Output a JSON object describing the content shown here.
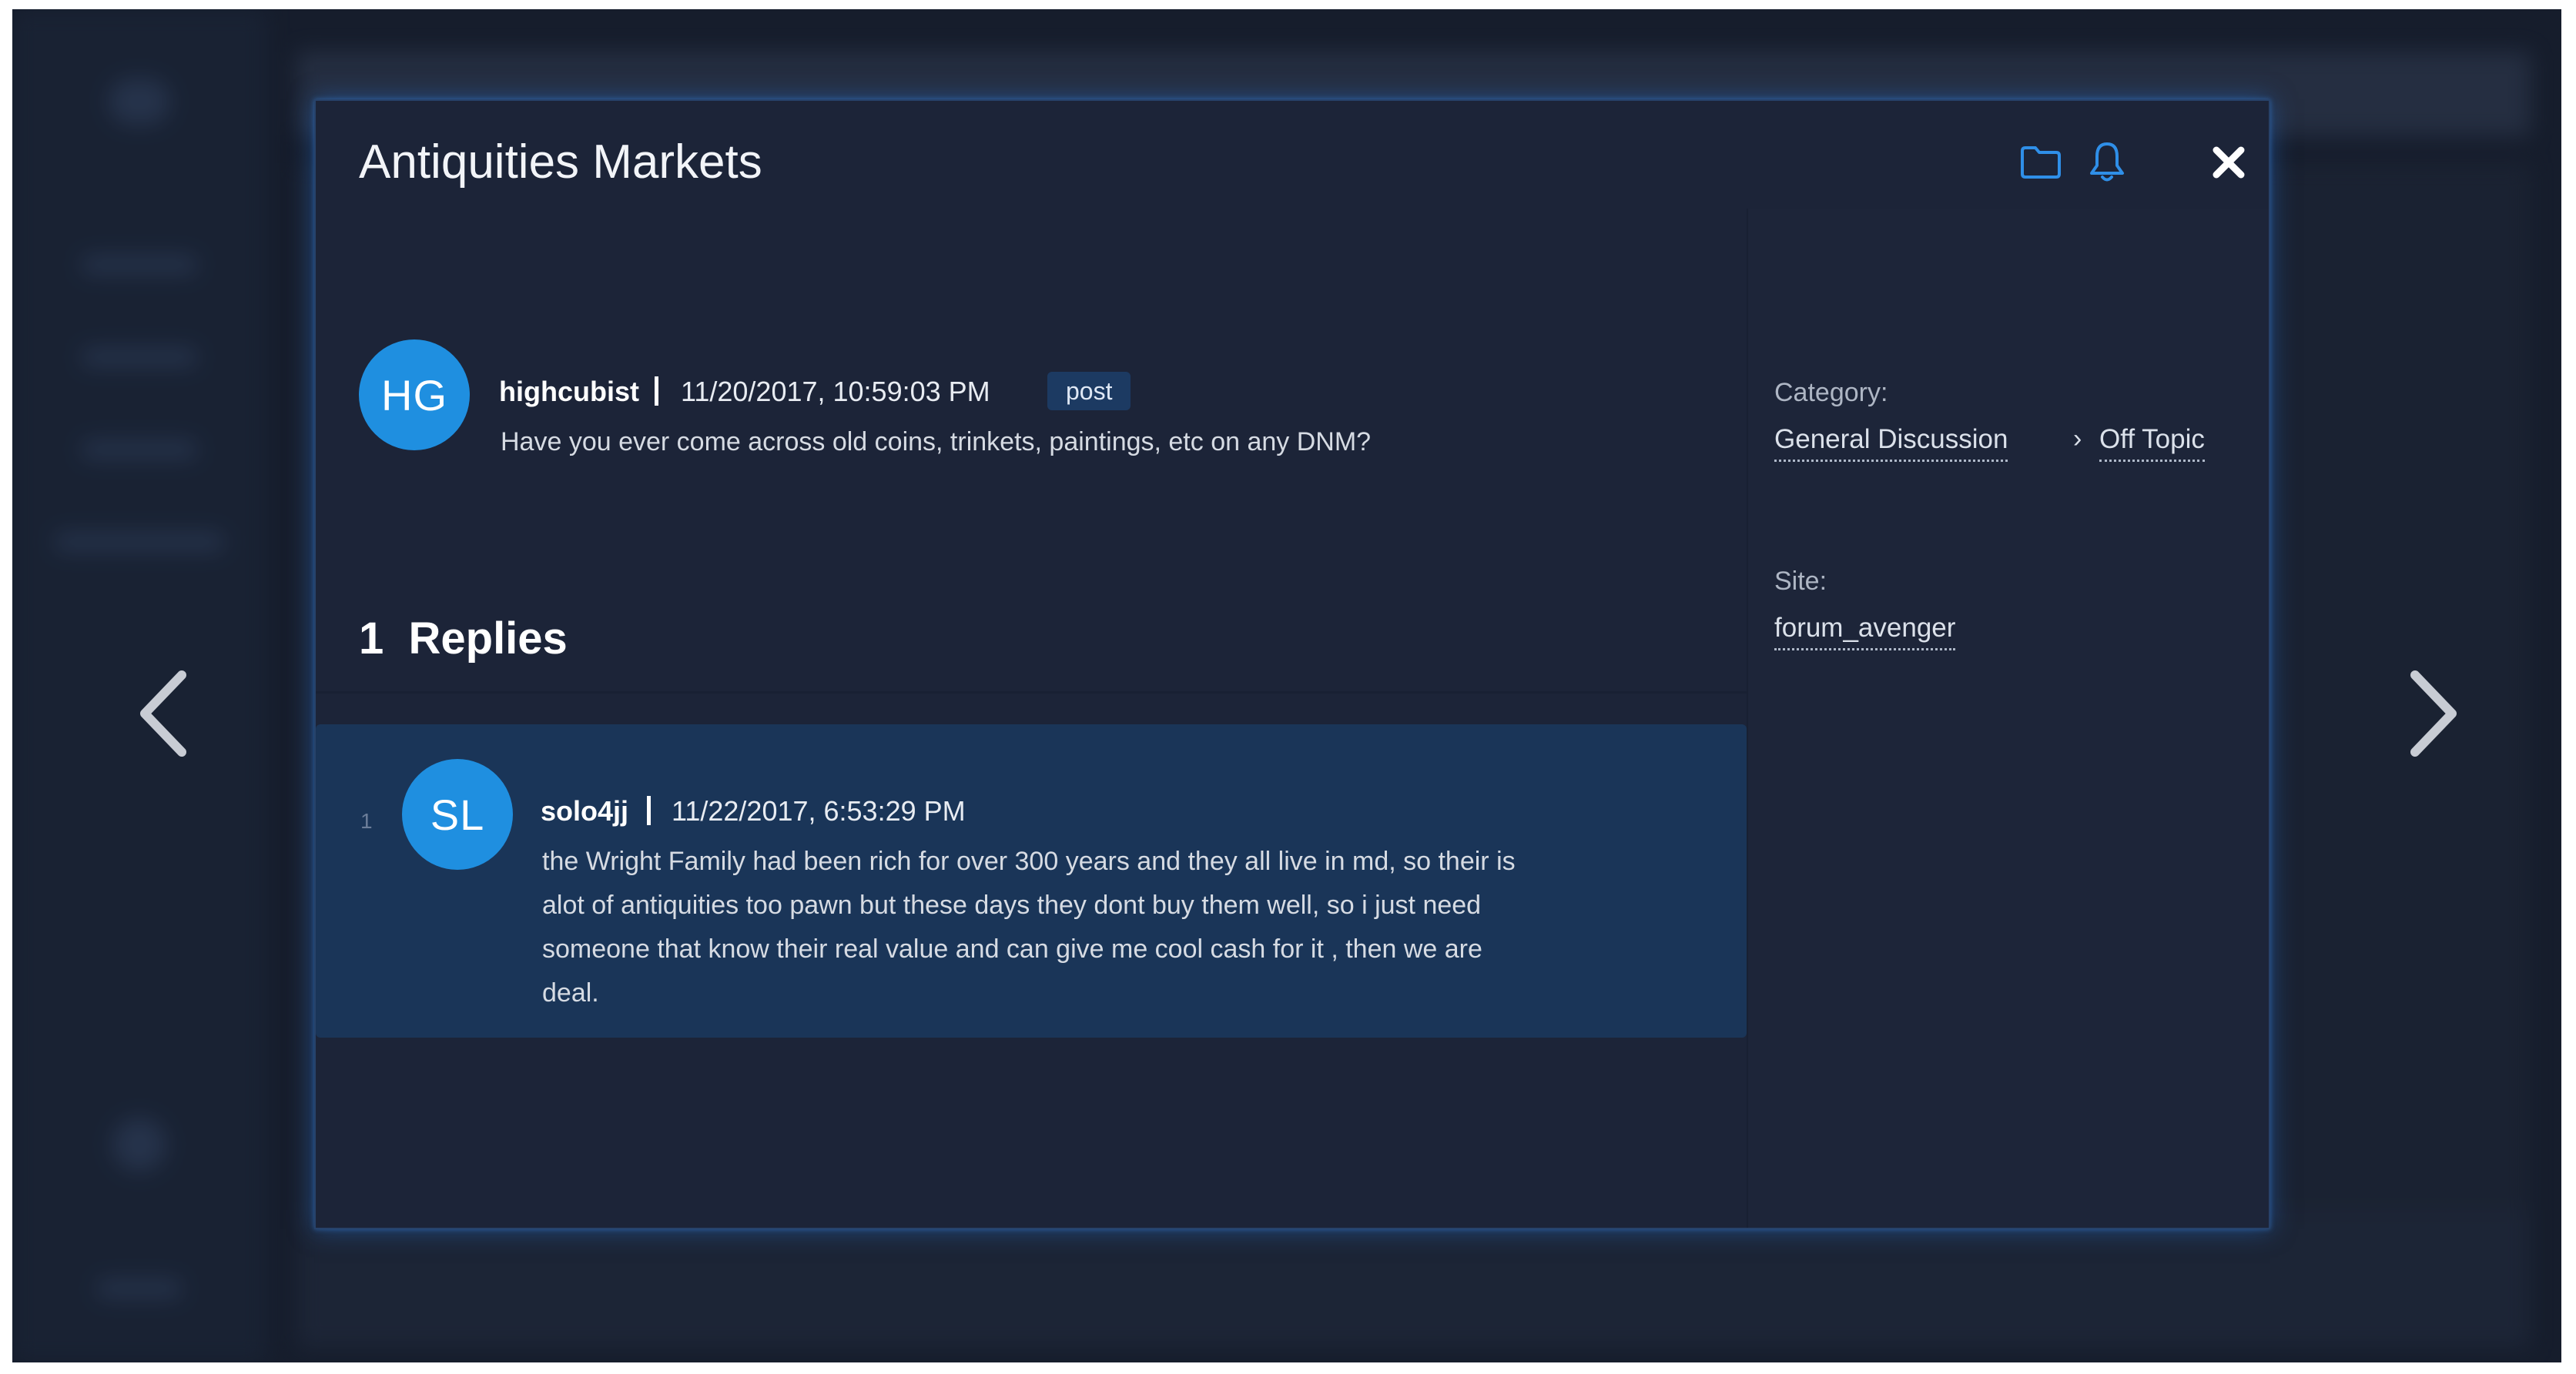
{
  "modal": {
    "title": "Antiquities Markets",
    "icons": [
      "folder-icon",
      "bell-icon",
      "close-icon"
    ]
  },
  "post": {
    "avatar_initials": "HG",
    "author": "highcubist",
    "date": "11/20/2017, 10:59:03 PM",
    "badge": "post",
    "text": "Have you ever come across old coins, trinkets, paintings, etc on any DNM?"
  },
  "replies": {
    "count": "1",
    "label": "Replies",
    "items": [
      {
        "index": "1",
        "avatar_initials": "SL",
        "author": "solo4jj",
        "date": "11/22/2017, 6:53:29 PM",
        "lines": [
          "the Wright Family had been rich for over 300 years and they all live in md, so their is",
          "alot of antiquities too pawn but these days they dont buy them well, so i just need",
          "someone that know their real value and can give me cool cash for it , then we are",
          "deal."
        ]
      }
    ]
  },
  "sidebar": {
    "category_label": "Category:",
    "category_parent": "General Discussion",
    "category_child": "Off Topic",
    "site_label": "Site:",
    "site_value": "forum_avenger"
  },
  "colors": {
    "accent": "#1f8fe0",
    "icon_blue": "#2f8fe8",
    "reply_highlight": "#1a3558",
    "modal_bg": "#1c2438"
  }
}
